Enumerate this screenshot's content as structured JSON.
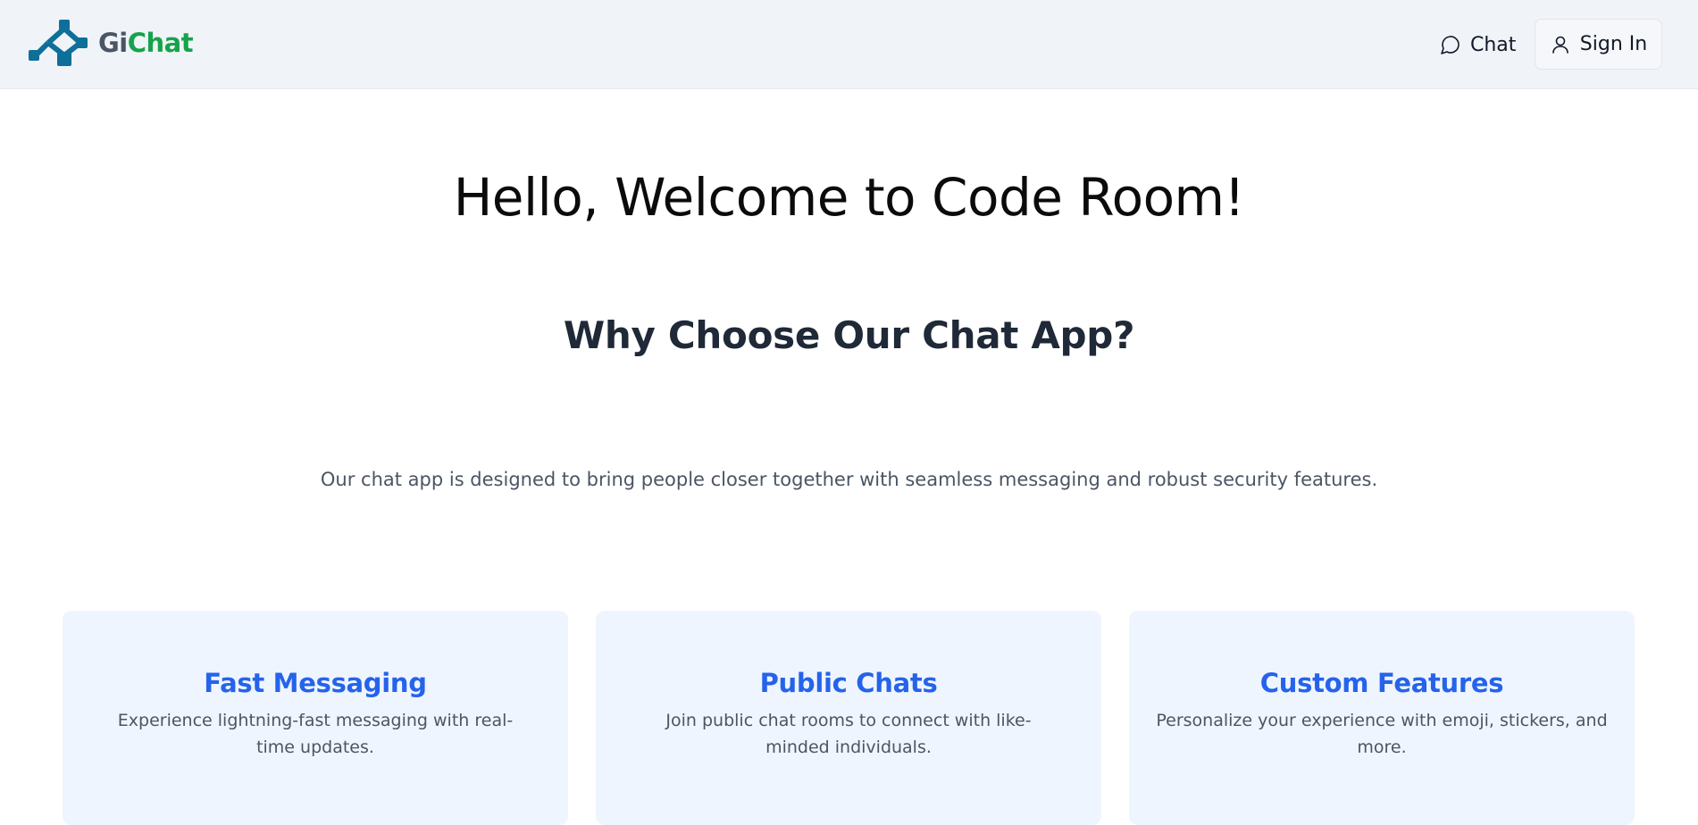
{
  "header": {
    "logo": {
      "part1": "Gi",
      "part2": "Chat"
    },
    "nav": {
      "chat_label": "Chat",
      "chat_icon": "chat-bubble-icon",
      "signin_label": "Sign In",
      "signin_icon": "user-icon"
    }
  },
  "main": {
    "hero_title": "Hello, Welcome to Code Room!",
    "why_title": "Why Choose Our Chat App?",
    "why_description": "Our chat app is designed to bring people closer together with seamless messaging and robust security features."
  },
  "features": [
    {
      "title": "Fast Messaging",
      "description": "Experience lightning-fast messaging with real-time updates."
    },
    {
      "title": "Public Chats",
      "description": "Join public chat rooms to connect with like-minded individuals."
    },
    {
      "title": "Custom Features",
      "description": "Personalize your experience with emoji, stickers, and more."
    }
  ],
  "colors": {
    "header_bg": "#f0f3f8",
    "logo_icon": "#0e6f99",
    "logo_gi": "#4a5565",
    "logo_chat": "#16a34a",
    "card_bg": "#eff5fe",
    "card_title": "#2563eb"
  }
}
